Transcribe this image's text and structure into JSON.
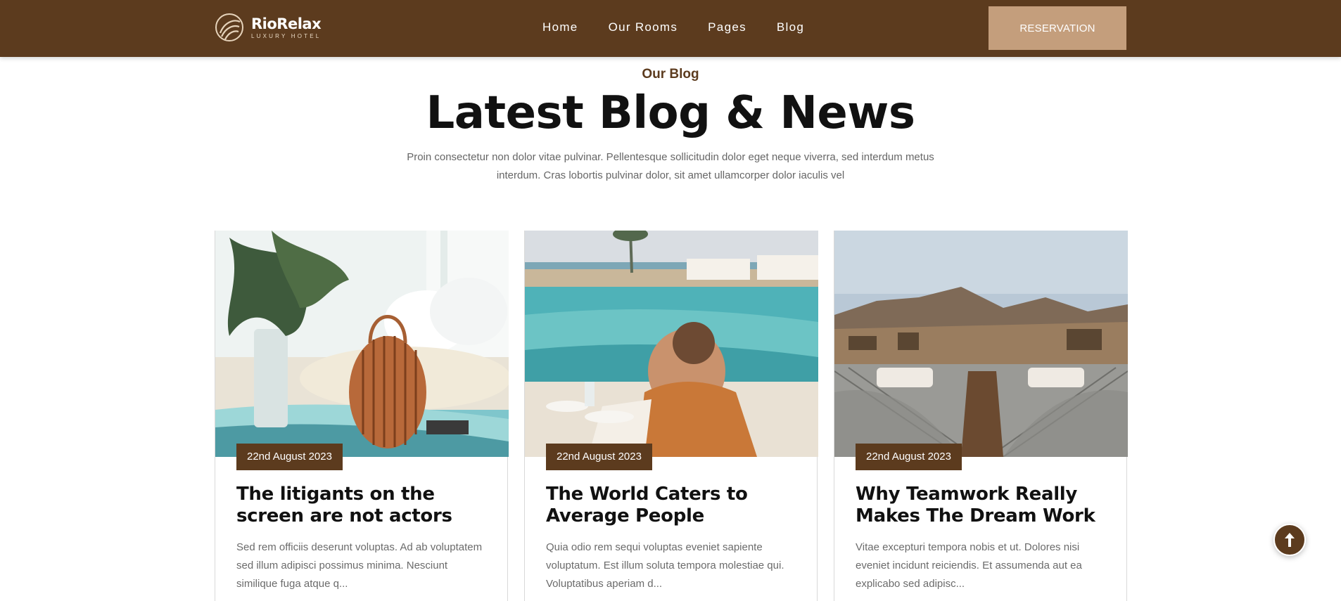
{
  "header": {
    "logo_name": "RioRelax",
    "logo_sub": "LUXURY HOTEL",
    "nav": [
      "Home",
      "Our Rooms",
      "Pages",
      "Blog"
    ],
    "reservation_label": "RESERVATION"
  },
  "section": {
    "eyebrow": "Our Blog",
    "title": "Latest Blog & News",
    "intro": "Proin consectetur non dolor vitae pulvinar. Pellentesque sollicitudin dolor eget neque viverra, sed interdum metus interdum. Cras lobortis pulvinar dolor, sit amet ullamcorper dolor iaculis vel"
  },
  "posts": [
    {
      "date": "22nd August 2023",
      "title": "The litigants on the screen are not actors",
      "excerpt": "Sed rem officiis deserunt voluptas. Ad ab voluptatem sed illum adipisci possimus minima. Nesciunt similique fuga atque q..."
    },
    {
      "date": "22nd August 2023",
      "title": "The World Caters to Average People",
      "excerpt": "Quia odio rem sequi voluptas eveniet sapiente voluptatum. Est illum soluta tempora molestiae qui. Voluptatibus aperiam d..."
    },
    {
      "date": "22nd August 2023",
      "title": "Why Teamwork Really Makes The Dream Work",
      "excerpt": "Vitae excepturi tempora nobis et ut. Dolores nisi eveniet incidunt reiciendis. Et assumenda aut ea explicabo sed adipisc..."
    }
  ],
  "colors": {
    "brand_brown": "#5c3b1e",
    "accent_tan": "#c49e7c"
  },
  "icons": {
    "logo": "riorelax-logo-icon",
    "scroll_top": "arrow-up-icon"
  }
}
